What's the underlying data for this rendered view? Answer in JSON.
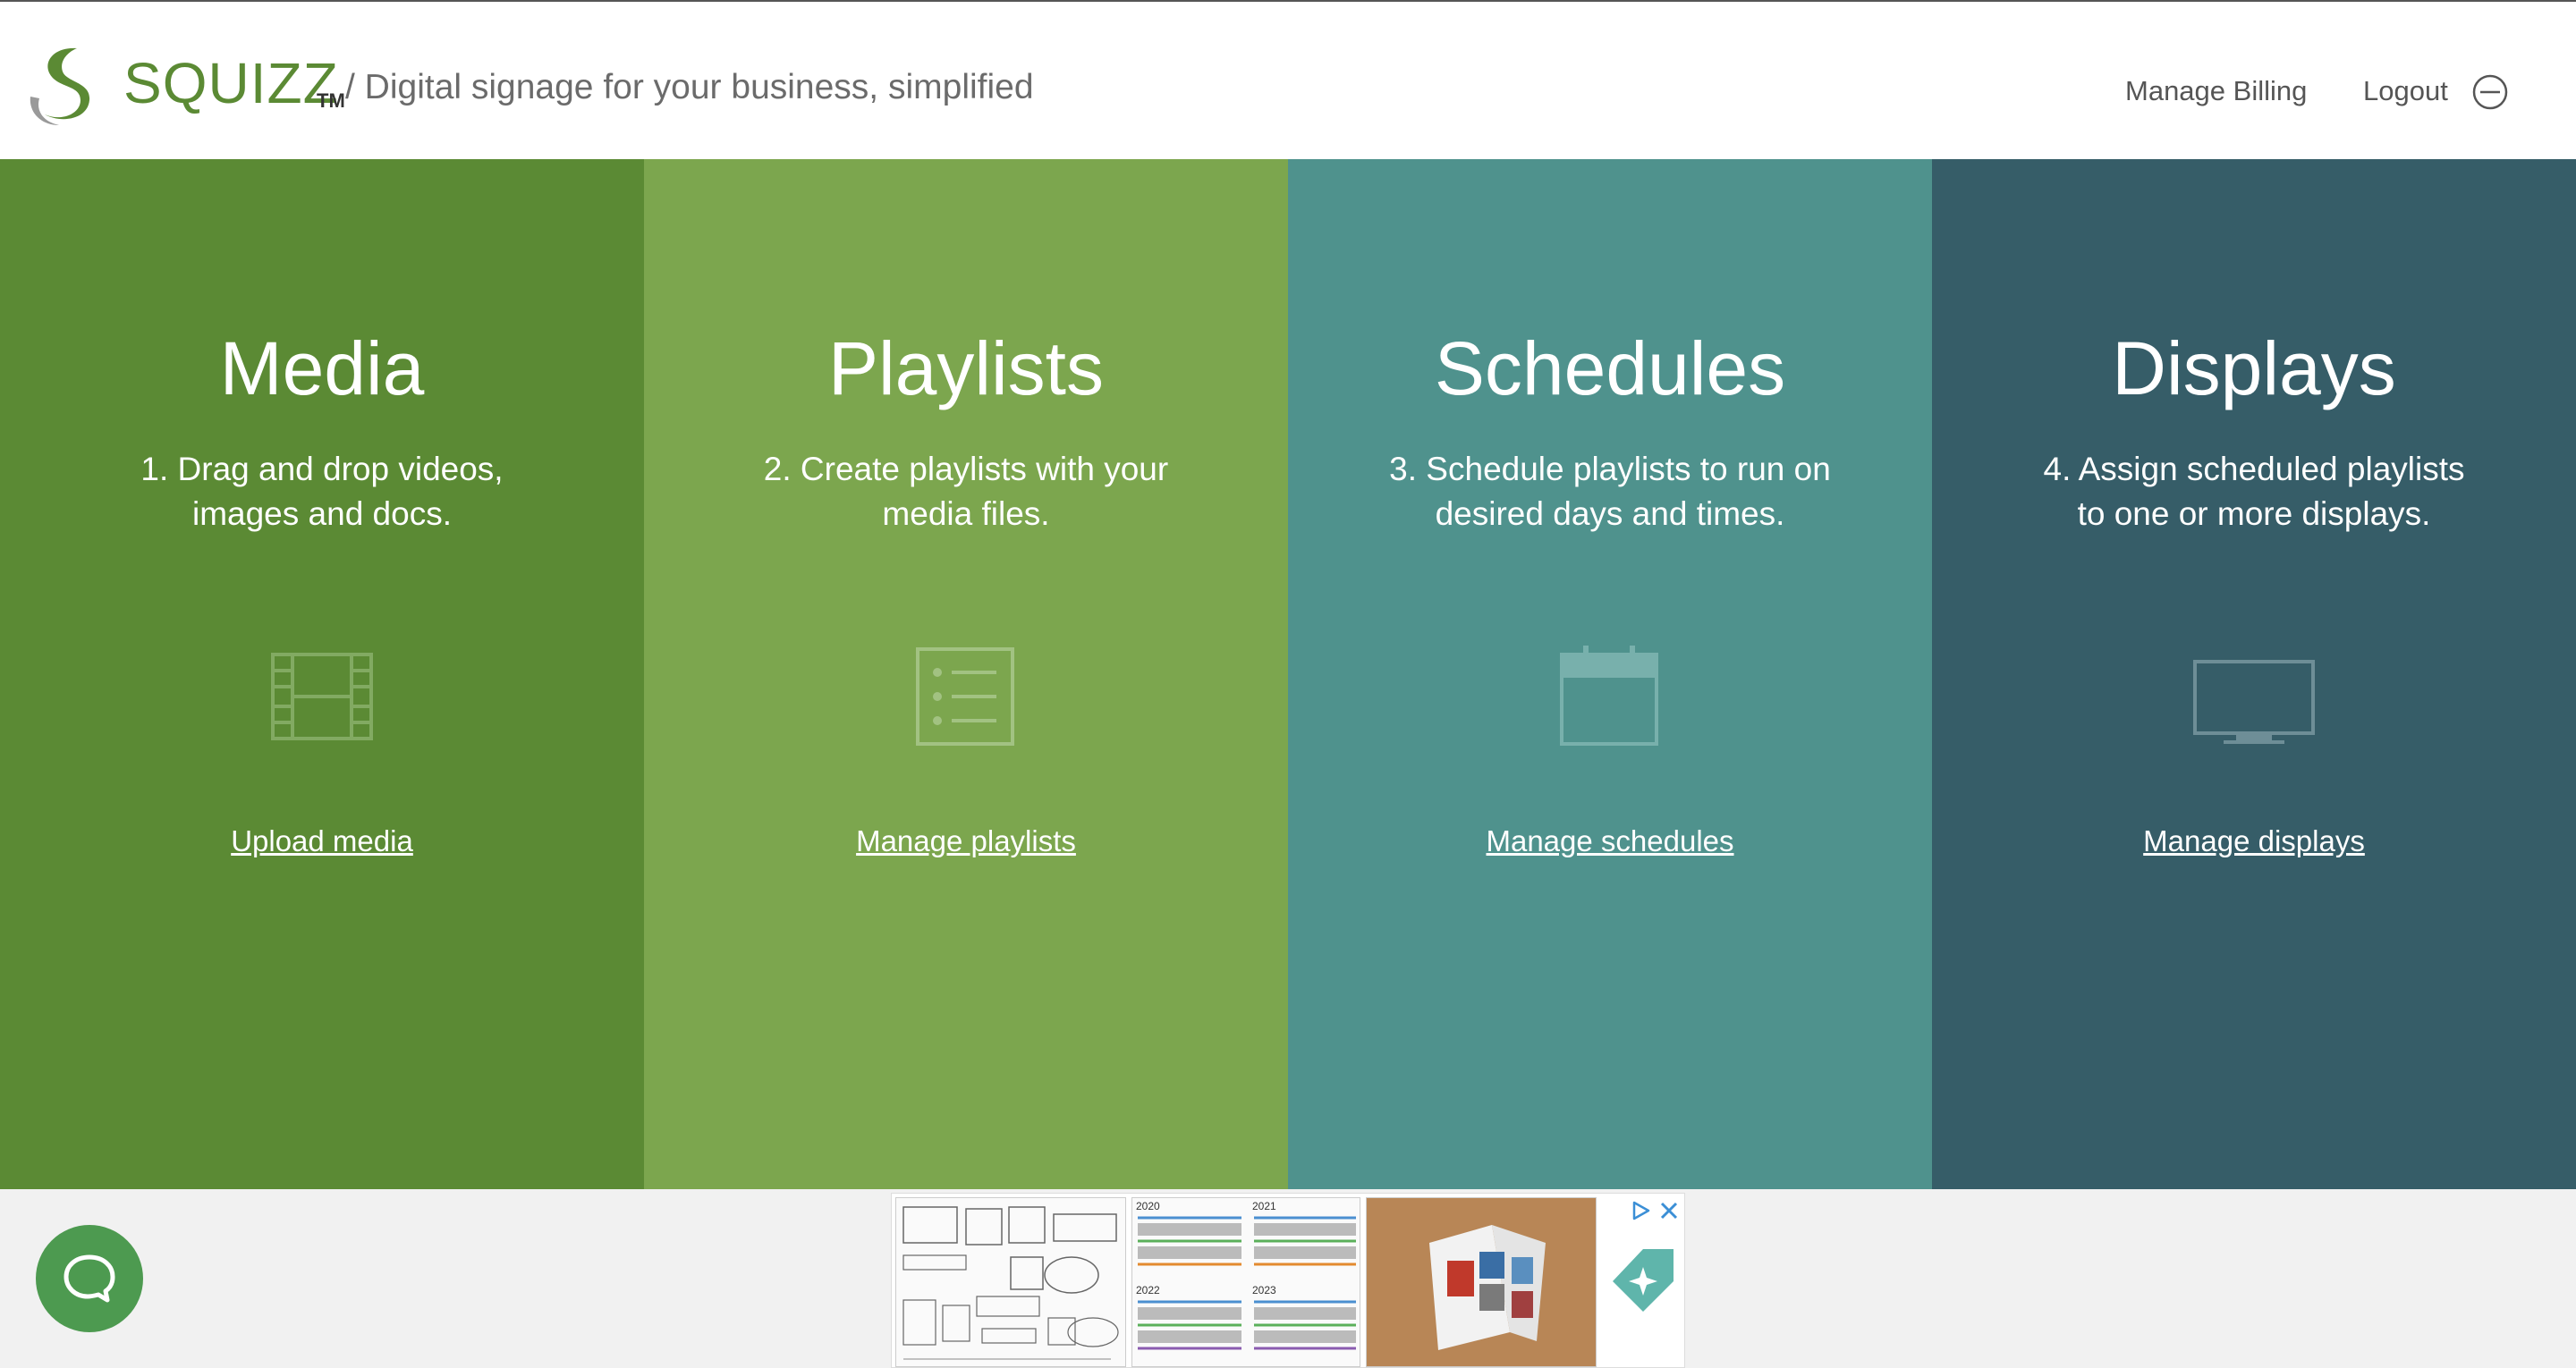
{
  "header": {
    "brand": "SQUIZZ",
    "trademark": "TM",
    "tagline": "/ Digital signage for your business, simplified",
    "nav": {
      "billing": "Manage Billing",
      "logout": "Logout"
    }
  },
  "panels": [
    {
      "title": "Media",
      "description": "1. Drag and drop videos, images and docs.",
      "icon": "film-icon",
      "link": "Upload media",
      "color": "#5b8a34"
    },
    {
      "title": "Playlists",
      "description": "2. Create playlists with your media files.",
      "icon": "list-icon",
      "link": "Manage playlists",
      "color": "#7ca64e"
    },
    {
      "title": "Schedules",
      "description": "3. Schedule playlists to run on desired days and times.",
      "icon": "calendar-icon",
      "link": "Manage schedules",
      "color": "#4f928d"
    },
    {
      "title": "Displays",
      "description": "4. Assign scheduled playlists to one or more displays.",
      "icon": "monitor-icon",
      "link": "Manage displays",
      "color": "#365d68"
    }
  ],
  "footer": {
    "chat_icon": "chat-bubble-icon",
    "ad": {
      "years": [
        "2020",
        "2021",
        "2022",
        "2023"
      ],
      "icons": [
        "ad-info-icon",
        "ad-close-icon",
        "tag-icon"
      ]
    }
  },
  "colors": {
    "brand_green": "#5b8a34",
    "media_panel": "#5b8a34",
    "playlists_panel": "#7ca64e",
    "schedules_panel": "#4f928d",
    "displays_panel": "#365d68",
    "chat_button": "#4d9a50"
  }
}
